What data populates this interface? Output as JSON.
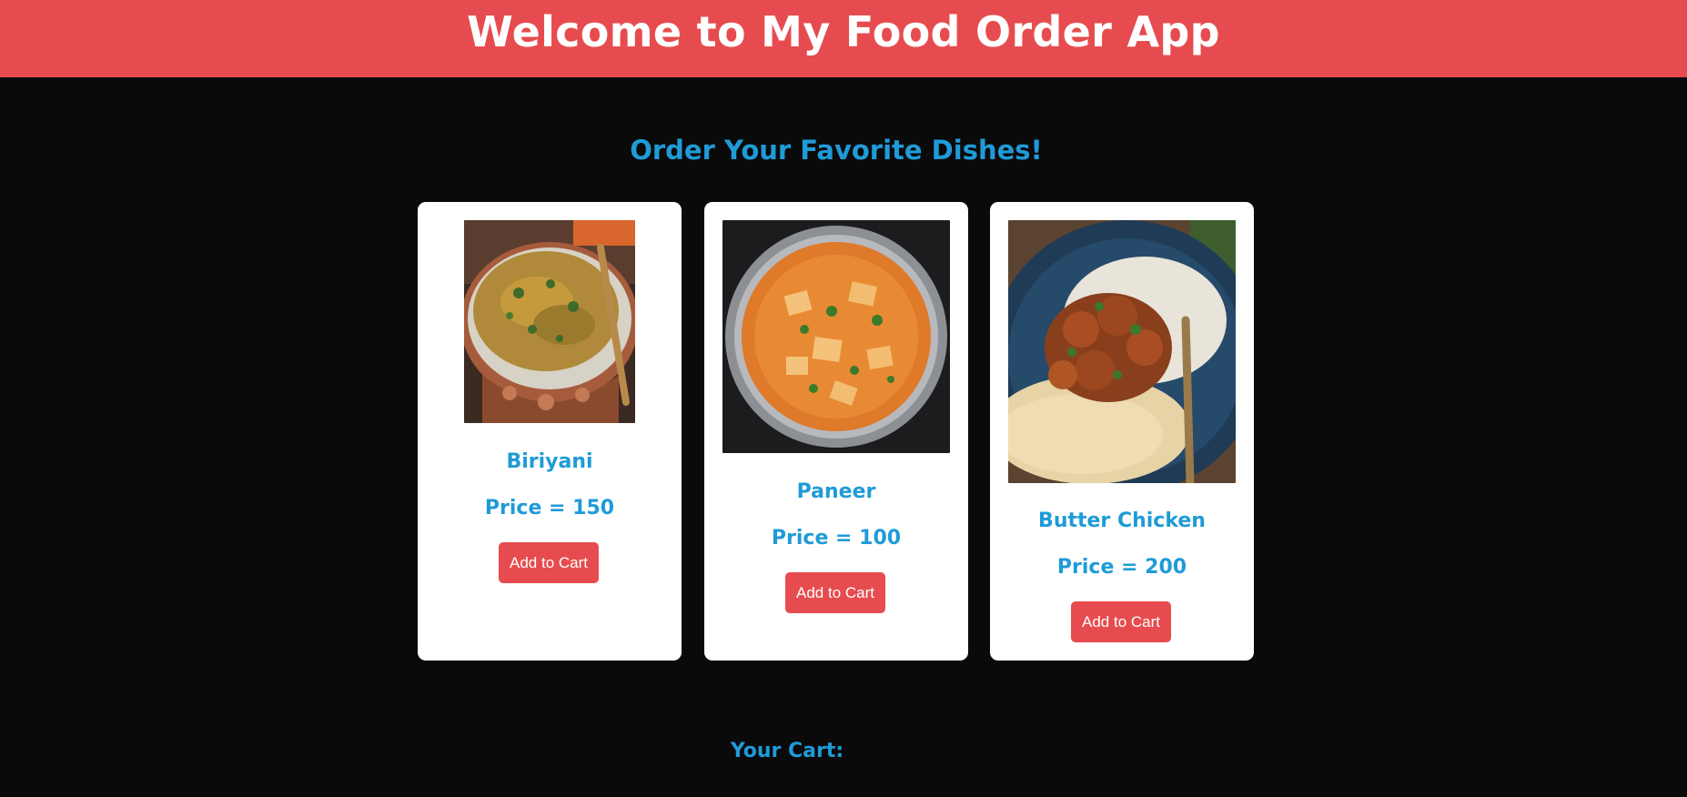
{
  "header": {
    "title": "Welcome to My Food Order App"
  },
  "main": {
    "subtitle": "Order Your Favorite Dishes!",
    "items": [
      {
        "name": "Biriyani",
        "price_label": "Price = 150",
        "button_label": "Add to Cart"
      },
      {
        "name": "Paneer",
        "price_label": "Price = 100",
        "button_label": "Add to Cart"
      },
      {
        "name": "Butter Chicken",
        "price_label": "Price = 200",
        "button_label": "Add to Cart"
      }
    ]
  },
  "cart": {
    "title": "Your Cart:"
  },
  "colors": {
    "accent": "#e64c4f",
    "text_blue": "#1f9bd7",
    "background": "#0a0a0b",
    "card": "#ffffff"
  }
}
